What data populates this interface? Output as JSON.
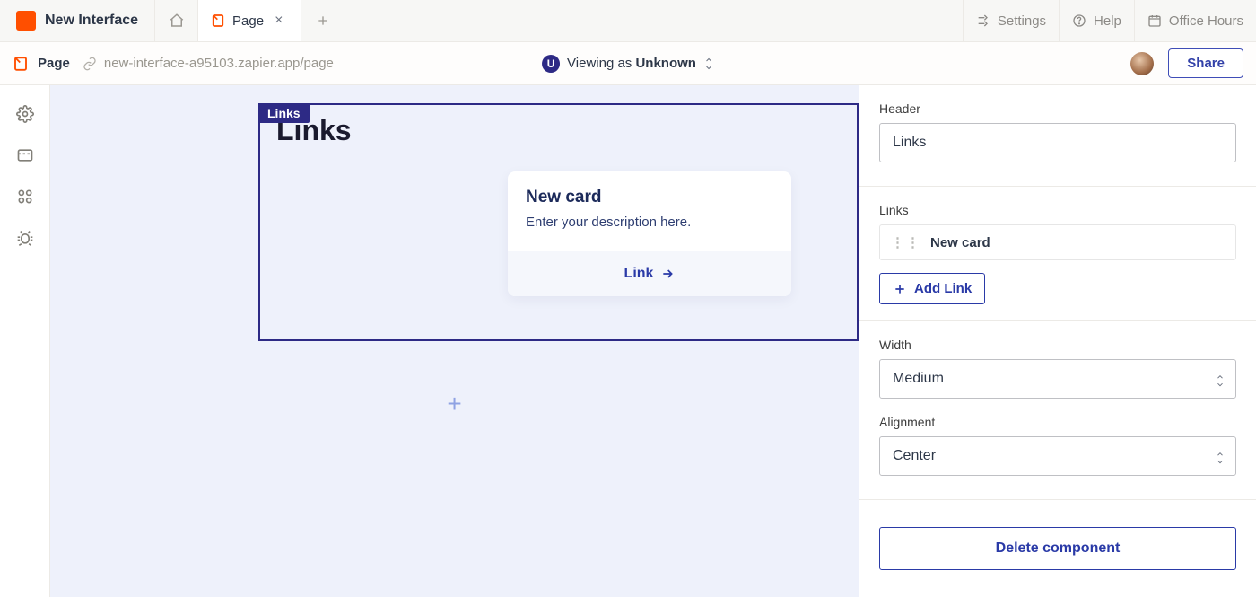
{
  "topbar": {
    "app_name": "New Interface",
    "active_tab": "Page",
    "settings": "Settings",
    "help": "Help",
    "office_hours": "Office Hours"
  },
  "secondbar": {
    "crumb": "Page",
    "url": "new-interface-a95103.zapier.app/page",
    "viewing_label": "Viewing as ",
    "viewing_user": "Unknown",
    "viewer_initial": "U",
    "share": "Share"
  },
  "canvas": {
    "block_tag": "Links",
    "block_title": "Links",
    "card": {
      "title": "New card",
      "description": "Enter your description here.",
      "link_label": "Link"
    }
  },
  "panel": {
    "header_label": "Header",
    "header_value": "Links",
    "links_label": "Links",
    "link_items": [
      "New card"
    ],
    "add_link": "Add Link",
    "width_label": "Width",
    "width_value": "Medium",
    "alignment_label": "Alignment",
    "alignment_value": "Center",
    "delete_label": "Delete component"
  }
}
